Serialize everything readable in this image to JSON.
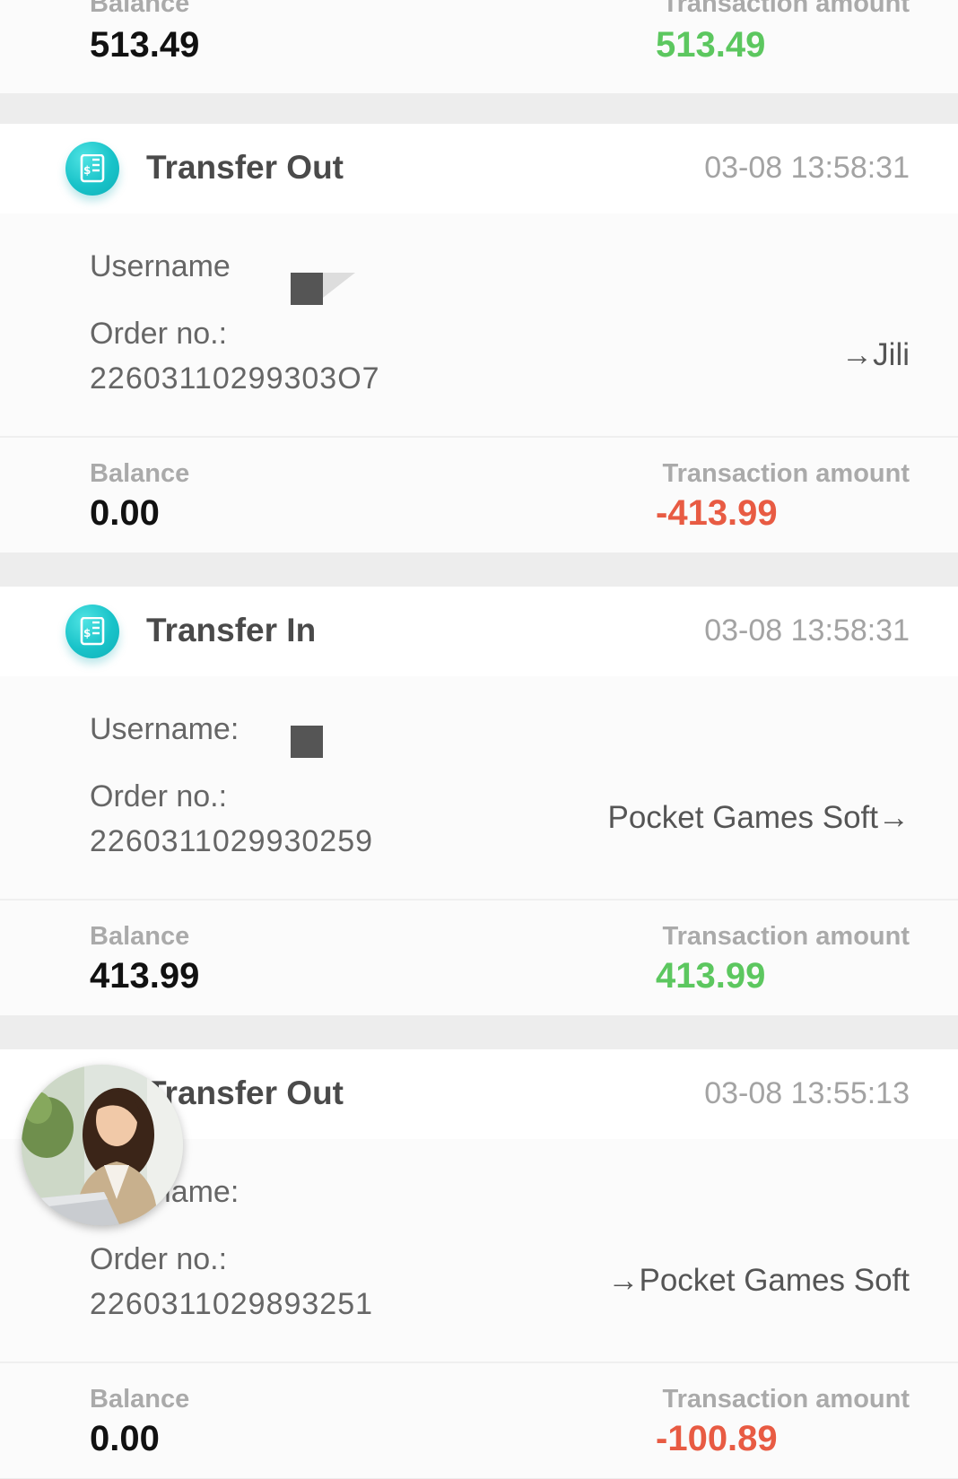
{
  "top_partial": {
    "balance_label": "Balance",
    "balance": "513.49",
    "amount_label": "Transaction amount",
    "amount": "513.49",
    "amount_color": "#5cc75f"
  },
  "transactions": [
    {
      "title": "Transfer Out",
      "time": "03-08 13:58:31",
      "username_label": "Username",
      "order_label": "Order no.:",
      "order_no": "22603110299303O7",
      "direction": "→Jili",
      "balance_label": "Balance",
      "balance": "0.00",
      "amount_label": "Transaction amount",
      "amount": "-413.99",
      "amount_color": "#e85b43",
      "icon": "receipt-dollar-icon"
    },
    {
      "title": "Transfer In",
      "time": "03-08 13:58:31",
      "username_label": "Username:",
      "order_label": "Order no.:",
      "order_no": "2260311029930259",
      "direction": "Pocket Games Soft→",
      "balance_label": "Balance",
      "balance": "413.99",
      "amount_label": "Transaction amount",
      "amount": "413.99",
      "amount_color": "#5cc75f",
      "icon": "receipt-dollar-icon"
    },
    {
      "title": "Transfer Out",
      "time": "03-08 13:55:13",
      "username_label": "Username:",
      "order_label": "Order no.:",
      "order_no": "2260311029893251",
      "direction": "→Pocket Games Soft",
      "balance_label": "Balance",
      "balance": "0.00",
      "amount_label": "Transaction amount",
      "amount": "-100.89",
      "amount_color": "#e85b43",
      "icon": "receipt-dollar-icon"
    }
  ],
  "overlay": {
    "avatar": "support-agent-avatar"
  }
}
